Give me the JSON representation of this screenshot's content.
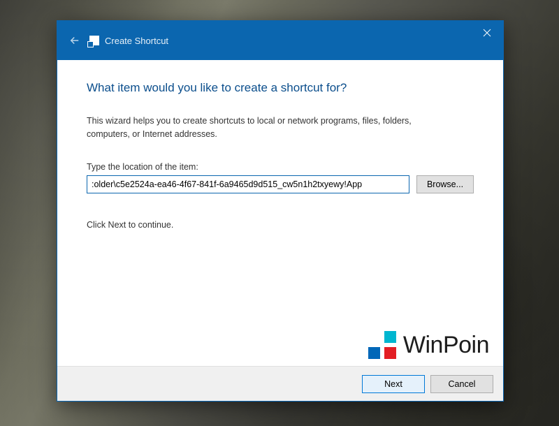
{
  "titlebar": {
    "title": "Create Shortcut"
  },
  "content": {
    "heading": "What item would you like to create a shortcut for?",
    "description": "This wizard helps you to create shortcuts to local or network programs, files, folders, computers, or Internet addresses.",
    "field_label": "Type the location of the item:",
    "location_value": ":older\\c5e2524a-ea46-4f67-841f-6a9465d9d515_cw5n1h2txyewy!App",
    "browse_label": "Browse...",
    "continue_text": "Click Next to continue."
  },
  "footer": {
    "next_label": "Next",
    "cancel_label": "Cancel"
  },
  "watermark": {
    "text": "WinPoin"
  }
}
